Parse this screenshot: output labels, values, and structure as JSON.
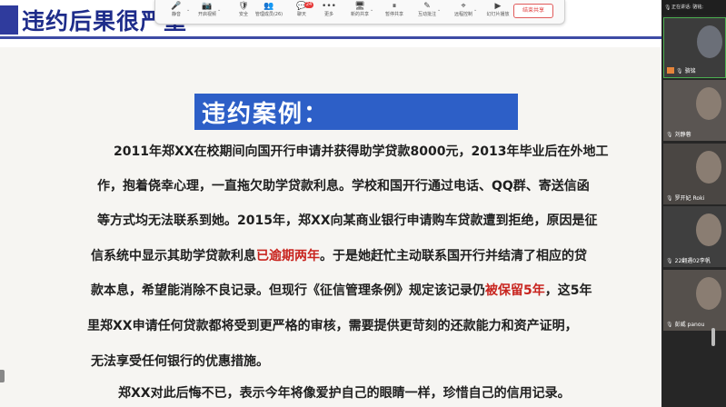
{
  "slide": {
    "header_title": "违约后果很严重",
    "case_title": "违约案例：",
    "paragraphs": [
      [
        {
          "t": "2011年郑XX在校期间向国开行申请并获得助学贷款8000元，2013年毕业后在外地工"
        }
      ],
      [
        {
          "t": "作，抱着侥幸心理，一直拖欠助学贷款利息。学校和国开行通过电话、QQ群、寄送信函"
        }
      ],
      [
        {
          "t": "等方式均无法联系到她。2015年，郑XX向某商业银行申请购车贷款遭到拒绝，原因是征"
        }
      ],
      [
        {
          "t": "信系统中显示其助学贷款利息"
        },
        {
          "t": "已逾期两年",
          "hl": true
        },
        {
          "t": "。于是她赶忙主动联系国开行并结清了相应的贷"
        }
      ],
      [
        {
          "t": "款本息，希望能消除不良记录。但现行《征信管理条例》规定该记录仍"
        },
        {
          "t": "被保留5年",
          "hl": true
        },
        {
          "t": "，这5年"
        }
      ],
      [
        {
          "t": "里郑XX申请任何贷款都将受到更严格的审核，需要提供更苛刻的还款能力和资产证明，"
        }
      ],
      [
        {
          "t": "无法享受任何银行的优惠措施。"
        }
      ],
      [
        {
          "t": "郑XX对此后悔不已，表示今年将像爱护自己的眼睛一样，珍惜自己的信用记录。"
        }
      ]
    ]
  },
  "toolbar": {
    "items": [
      {
        "icon": "microphone-icon",
        "glyph": "🎤",
        "label": "静音",
        "caret": true
      },
      {
        "icon": "camera-icon",
        "glyph": "📷",
        "label": "开启视频",
        "caret": true
      },
      {
        "icon": "shield-icon",
        "glyph": "🛡",
        "label": "安全",
        "caret": false
      },
      {
        "icon": "participants-icon",
        "glyph": "👥",
        "label": "管理成员(26)",
        "caret": false
      },
      {
        "icon": "chat-icon",
        "glyph": "💬",
        "label": "聊天",
        "caret": false,
        "badge": "24"
      },
      {
        "icon": "more-icon",
        "glyph": "•••",
        "label": "更多",
        "caret": false
      },
      {
        "icon": "new-share-icon",
        "glyph": "🖥",
        "label": "新的共享",
        "caret": true
      },
      {
        "icon": "pause-share-icon",
        "glyph": "⏸",
        "label": "暂停共享",
        "caret": false
      },
      {
        "icon": "annotate-icon",
        "glyph": "✎",
        "label": "互动批注",
        "caret": true
      },
      {
        "icon": "remote-control-icon",
        "glyph": "⌖",
        "label": "远程控制",
        "caret": true
      },
      {
        "icon": "video-play-icon",
        "glyph": "▶",
        "label": "幻灯片播放",
        "caret": false
      }
    ],
    "end_share": "结束共享"
  },
  "panel": {
    "speaking_label": "正在讲话: 骆铭;",
    "participants": [
      {
        "name": "骆铭",
        "host": true,
        "active": true,
        "bg": "#3c3c3c"
      },
      {
        "name": "刘静蓉",
        "host": false,
        "active": false,
        "bg": "#5a5552"
      },
      {
        "name": "罗开妃 Roki",
        "host": false,
        "active": false,
        "bg": "#4a4643"
      },
      {
        "name": "22翻遇02李帆",
        "host": false,
        "active": false,
        "bg": "#3f3f3f"
      },
      {
        "name": "彭威 panou",
        "host": false,
        "active": false,
        "bg": "#55504c"
      }
    ]
  }
}
